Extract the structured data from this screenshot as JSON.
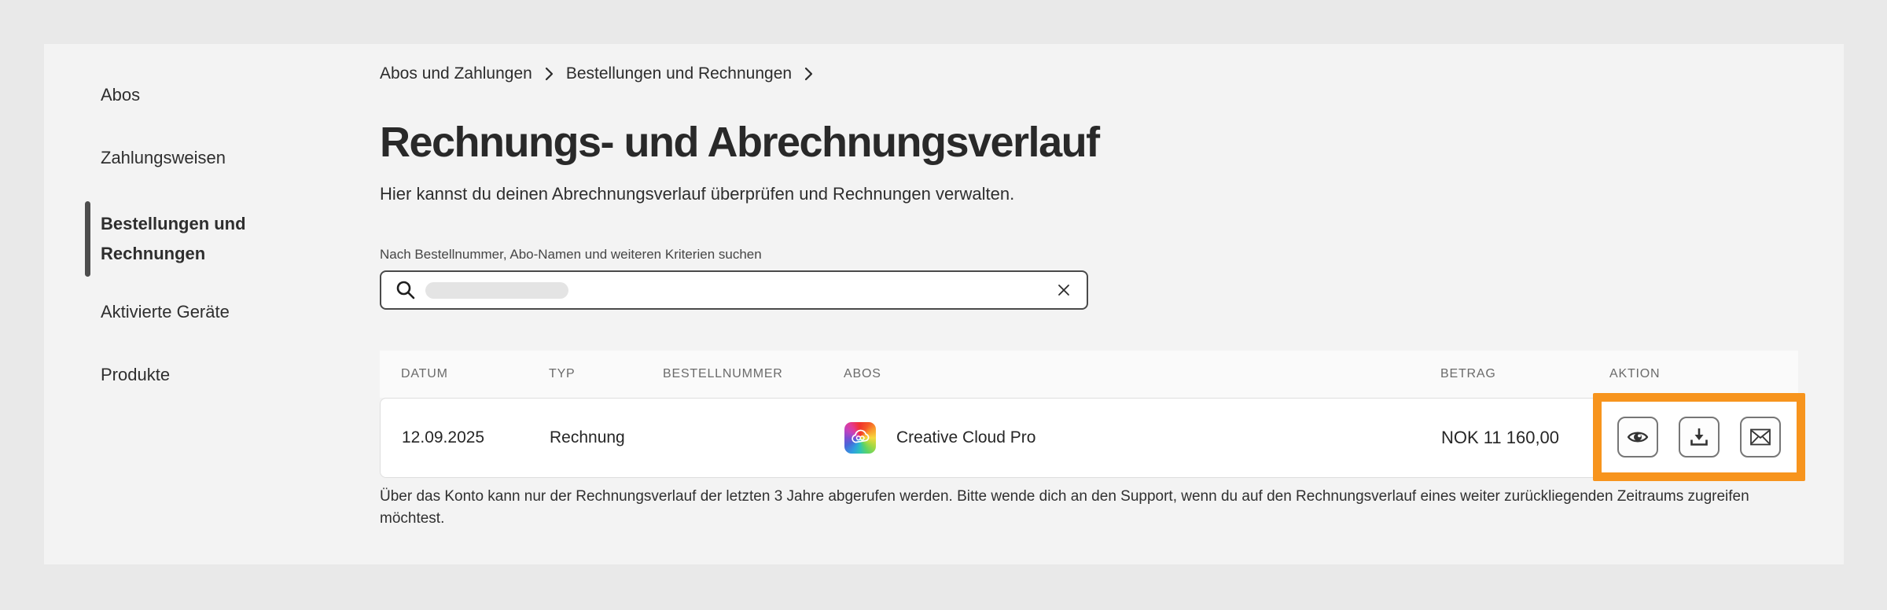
{
  "sidebar": {
    "items": [
      {
        "label": "Abos",
        "active": false
      },
      {
        "label": "Zahlungsweisen",
        "active": false
      },
      {
        "label": "Bestellungen und Rechnungen",
        "active": true
      },
      {
        "label": "Aktivierte Geräte",
        "active": false
      },
      {
        "label": "Produkte",
        "active": false
      }
    ]
  },
  "breadcrumb": {
    "items": [
      {
        "label": "Abos und Zahlungen"
      },
      {
        "label": "Bestellungen und Rechnungen"
      }
    ]
  },
  "page": {
    "title": "Rechnungs- und Abrechnungsverlauf",
    "subtitle": "Hier kannst du deinen Abrechnungsverlauf überprüfen und Rechnungen verwalten."
  },
  "search": {
    "label": "Nach Bestellnummer, Abo-Namen und weiteren Kriterien suchen",
    "value": "",
    "icons": {
      "left": "search-icon",
      "right": "close-icon"
    }
  },
  "invoice_table": {
    "headers": {
      "date": "DATUM",
      "type": "TYP",
      "order_number": "BESTELLNUMMER",
      "subscriptions": "ABOS",
      "amount": "BETRAG",
      "action": "AKTION"
    },
    "row": {
      "date": "12.09.2025",
      "type": "Rechnung",
      "product": "Creative Cloud Pro",
      "amount": "NOK 11 160,00"
    },
    "actions": [
      {
        "icon": "eye-icon"
      },
      {
        "icon": "download-icon"
      },
      {
        "icon": "mail-icon"
      }
    ]
  },
  "note": "Über das Konto kann nur der Rechnungsverlauf der letzten 3 Jahre abgerufen werden. Bitte wende dich an den Support, wenn du auf den Rechnungsverlauf eines weiter zurückliegenden Zeitraums zugreifen möchtest.",
  "colors": {
    "highlight_orange": "#f7941d",
    "active_indicator": "#4d4d4d",
    "page_background": "#e9e9e9",
    "card_background": "#f3f3f3"
  }
}
